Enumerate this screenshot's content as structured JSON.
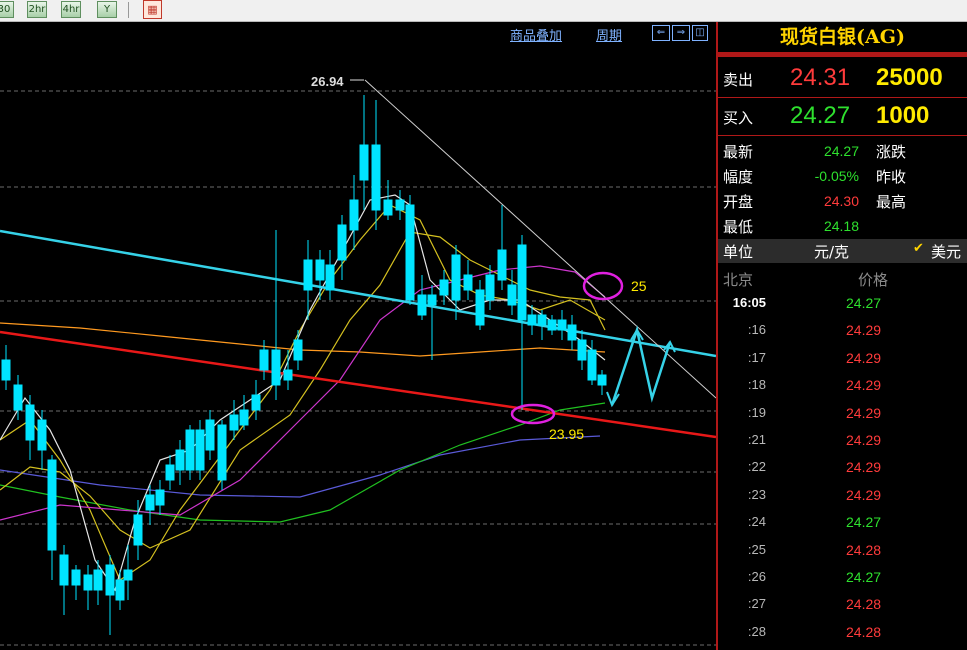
{
  "toolbar": {
    "buttons": [
      "30",
      "2hr",
      "4hr",
      "Y"
    ],
    "calendar_icon": "calendar-icon"
  },
  "chart_header": {
    "overlay_label": "商品叠加",
    "period_label": "周期"
  },
  "chart_data": {
    "type": "candlestick",
    "annotations": {
      "high_label": "26.94",
      "resistance_label": "25",
      "support_label": "23.95"
    },
    "colors": {
      "up": "#ff4545",
      "down": "#00e5ff",
      "trend_cyan": "#36d2e8",
      "trend_red": "#e81818",
      "ma5": "#e6e6e6",
      "ma10": "#d4c020",
      "ma20": "#cc35cc",
      "ma30": "#ff9a20",
      "ma60": "#20c020",
      "ma120": "#5a5ad8",
      "ellipse": "#e020e0"
    }
  },
  "panel": {
    "title": "现货白银(AG)",
    "sell": {
      "label": "卖出",
      "price": "24.31",
      "volume": "25000"
    },
    "buy": {
      "label": "买入",
      "price": "24.27",
      "volume": "1000"
    },
    "stats": {
      "latest_label": "最新",
      "latest_value": "24.27",
      "change_label": "涨跌",
      "range_label": "幅度",
      "range_value": "-0.05%",
      "prev_close_label": "昨收",
      "open_label": "开盘",
      "open_value": "24.30",
      "high_label": "最高",
      "low_label": "最低",
      "low_value": "24.18"
    },
    "unit": {
      "label": "单位",
      "value": "元/克",
      "currency": "美元"
    },
    "ticks_header": {
      "time": "北京",
      "price": "价格"
    },
    "ticks": [
      {
        "time": "16:05",
        "price": "24.27",
        "dir": "down"
      },
      {
        "time": ":16",
        "price": "24.29",
        "dir": "up"
      },
      {
        "time": ":17",
        "price": "24.29",
        "dir": "up"
      },
      {
        "time": ":18",
        "price": "24.29",
        "dir": "up"
      },
      {
        "time": ":19",
        "price": "24.29",
        "dir": "up"
      },
      {
        "time": ":21",
        "price": "24.29",
        "dir": "up"
      },
      {
        "time": ":22",
        "price": "24.29",
        "dir": "up"
      },
      {
        "time": ":23",
        "price": "24.29",
        "dir": "up"
      },
      {
        "time": ":24",
        "price": "24.27",
        "dir": "down"
      },
      {
        "time": ":25",
        "price": "24.28",
        "dir": "up"
      },
      {
        "time": ":26",
        "price": "24.27",
        "dir": "down"
      },
      {
        "time": ":27",
        "price": "24.28",
        "dir": "up"
      },
      {
        "time": ":28",
        "price": "24.28",
        "dir": "up"
      }
    ]
  }
}
